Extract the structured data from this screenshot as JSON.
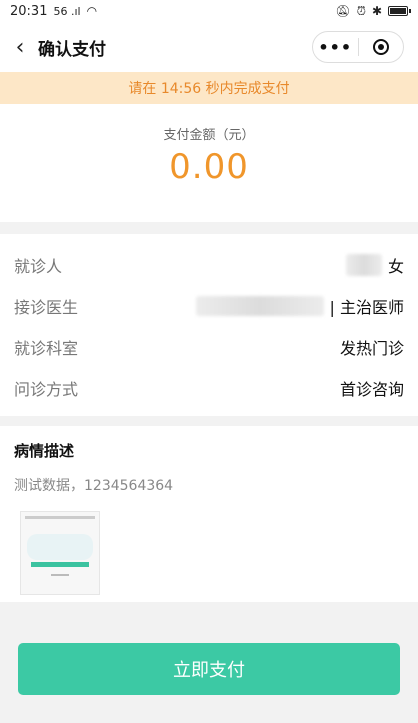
{
  "status_bar": {
    "time": "20:31",
    "signal_text": "56 .ıl",
    "wifi_icon": "wifi-icon"
  },
  "nav": {
    "title": "确认支付",
    "more": "•••"
  },
  "countdown": {
    "text": "请在 14:56 秒内完成支付"
  },
  "payment": {
    "label": "支付金额（元）",
    "amount": "0.00"
  },
  "info": {
    "rows": [
      {
        "label": "就诊人",
        "value": "女"
      },
      {
        "label": "接诊医生",
        "value": "| 主治医师"
      },
      {
        "label": "就诊科室",
        "value": "发热门诊"
      },
      {
        "label": "问诊方式",
        "value": "首诊咨询"
      }
    ]
  },
  "description": {
    "title": "病情描述",
    "text": "测试数据，1234564364"
  },
  "button": {
    "label": "立即支付"
  },
  "colors": {
    "accent": "#3cc9a4",
    "amount": "#f0962b",
    "banner_bg": "#fde7c7",
    "banner_text": "#e8892b"
  }
}
